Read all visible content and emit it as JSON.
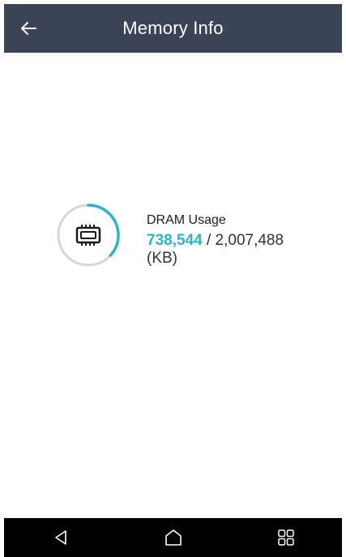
{
  "header": {
    "title": "Memory Info",
    "back_icon": "arrow-left-icon"
  },
  "dram": {
    "label": "DRAM Usage",
    "used": "738,544",
    "separator": " / ",
    "total": "2,007,488",
    "unit": "(KB)",
    "usage_fraction": 0.3679,
    "icon": "memory-chip-icon",
    "accent_color": "#2bb6c7",
    "track_color": "#d5d5d5"
  },
  "navbar": {
    "back_icon": "nav-back-icon",
    "home_icon": "nav-home-icon",
    "recents_icon": "nav-recents-icon"
  },
  "colors": {
    "app_bar": "#3b4357",
    "nav_bar": "#000000"
  }
}
